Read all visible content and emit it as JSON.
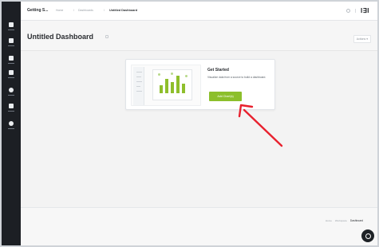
{
  "topbar": {
    "brand": "Getting S...",
    "crumbs": [
      "Home",
      "Dashboards"
    ],
    "crumb_sep": "/",
    "current": "Untitled Dashboard",
    "logo": "I∃I"
  },
  "page": {
    "title": "Untitled Dashboard",
    "right_button": "Actions ▾"
  },
  "get_started": {
    "title": "Get Started",
    "description": "Visualize data from a source to build a dashboard.",
    "button": "Add Chart(s)"
  },
  "footer": {
    "crumbs": [
      "Home",
      "Workspace"
    ],
    "current": "Dashboard"
  },
  "annotation": {
    "arrow_color": "#e8212e"
  },
  "sidebar": {
    "icons": [
      "home-icon",
      "grid-icon",
      "chart-icon",
      "data-icon",
      "settings-icon",
      "user-icon",
      "help-icon"
    ]
  },
  "colors": {
    "accent": "#8cbf2b",
    "sidebar": "#1c1f24"
  }
}
